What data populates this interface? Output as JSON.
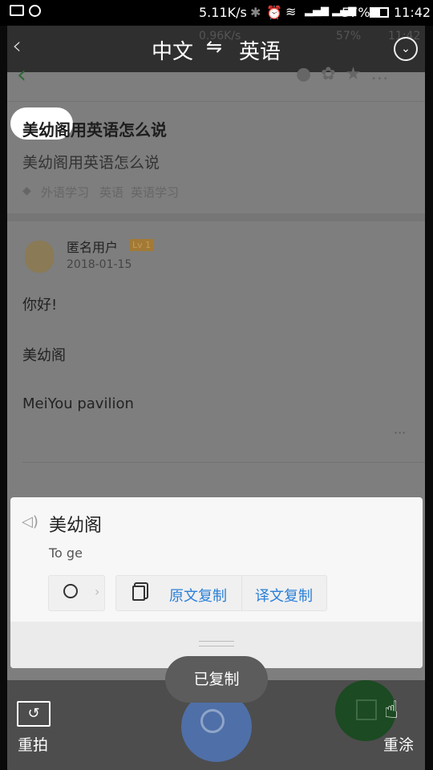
{
  "status_bar": {
    "speed": "5.11K/s",
    "battery": "57%",
    "time": "11:42",
    "ghost_speed": "0.96K/s",
    "ghost_battery": "57%",
    "ghost_time": "11:42"
  },
  "top_bar": {
    "source_lang": "中文",
    "swap_symbol": "⇋",
    "target_lang": "英语"
  },
  "question": {
    "title": "美幼阁用英语怎么说",
    "subtitle": "美幼阁用英语怎么说",
    "tags": [
      "外语学习",
      "英语",
      "英语学习"
    ]
  },
  "answer": {
    "user": "匿名用户",
    "level": "Lv 1",
    "date": "2018-01-15",
    "lines": [
      "你好!",
      "美幼阁",
      "MeiYou pavilion"
    ],
    "more": "···"
  },
  "translation_card": {
    "source": "美幼阁",
    "result": "To ge",
    "copy_source": "原文复制",
    "copy_translation": "译文复制"
  },
  "toast": "已复制",
  "bottom_bar": {
    "retake": "重拍",
    "repaint": "重涂"
  },
  "colors": {
    "accent_blue": "#2a7fd8",
    "search_fab": "#4f6fa8",
    "edit_fab": "#1c4a22"
  }
}
